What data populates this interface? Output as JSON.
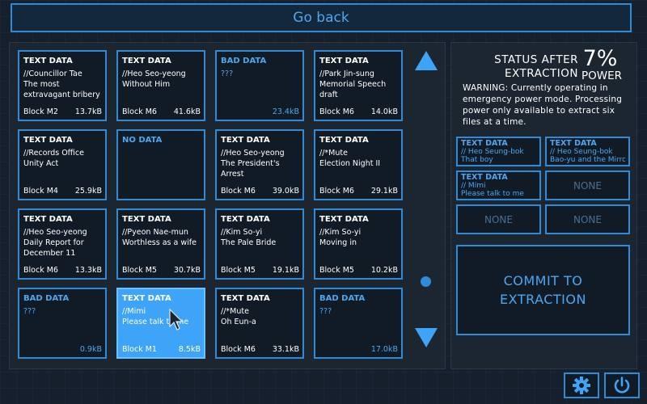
{
  "header": {
    "go_back_label": "Go back"
  },
  "cards": [
    {
      "type": "TEXT DATA",
      "sender": "//Councillor Tae",
      "subject": "The most extravagant bribery",
      "block": "Block M2",
      "size": "13.7kB",
      "variant": "normal"
    },
    {
      "type": "TEXT DATA",
      "sender": "//Heo Seo-yeong",
      "subject": "Without Him",
      "block": "Block M6",
      "size": "41.6kB",
      "variant": "normal"
    },
    {
      "type": "BAD DATA",
      "sender": "???",
      "subject": "",
      "block": "",
      "size": "23.4kB",
      "variant": "bad"
    },
    {
      "type": "TEXT DATA",
      "sender": "//Park Jin-sung",
      "subject": "Memorial Speech draft",
      "block": "Block M6",
      "size": "14.0kB",
      "variant": "normal"
    },
    {
      "type": "TEXT DATA",
      "sender": "//Records Office",
      "subject": "Unity Act",
      "block": "Block M4",
      "size": "25.9kB",
      "variant": "normal"
    },
    {
      "type": "NO DATA",
      "sender": "",
      "subject": "",
      "block": "",
      "size": "",
      "variant": "nodata"
    },
    {
      "type": "TEXT DATA",
      "sender": "//Heo Seo-yeong",
      "subject": "The President's Arrest",
      "block": "Block M6",
      "size": "39.0kB",
      "variant": "normal"
    },
    {
      "type": "TEXT DATA",
      "sender": "//*Mute",
      "subject": "Election Night II",
      "block": "Block M6",
      "size": "29.1kB",
      "variant": "normal"
    },
    {
      "type": "TEXT DATA",
      "sender": "//Heo Seo-yeong",
      "subject": "Daily Report for December 11",
      "block": "Block M6",
      "size": "13.3kB",
      "variant": "normal"
    },
    {
      "type": "TEXT DATA",
      "sender": "//Pyeon Nae-mun",
      "subject": "Worthless as a wife",
      "block": "Block M5",
      "size": "30.7kB",
      "variant": "normal"
    },
    {
      "type": "TEXT DATA",
      "sender": "//Kim So-yi",
      "subject": "The Pale Bride",
      "block": "Block M5",
      "size": "19.1kB",
      "variant": "normal"
    },
    {
      "type": "TEXT DATA",
      "sender": "//Kim So-yi",
      "subject": "Moving in",
      "block": "Block M5",
      "size": "10.2kB",
      "variant": "normal"
    },
    {
      "type": "BAD DATA",
      "sender": "???",
      "subject": "",
      "block": "",
      "size": "0.9kB",
      "variant": "bad"
    },
    {
      "type": "TEXT DATA",
      "sender": "//Mimi",
      "subject": "Please talk to me",
      "block": "Block M1",
      "size": "8.5kB",
      "variant": "selected"
    },
    {
      "type": "TEXT DATA",
      "sender": "//*Mute",
      "subject": "Oh Eun-a",
      "block": "Block M6",
      "size": "33.1kB",
      "variant": "normal"
    },
    {
      "type": "BAD DATA",
      "sender": "???",
      "subject": "",
      "block": "",
      "size": "17.0kB",
      "variant": "bad"
    }
  ],
  "status": {
    "title_line1": "STATUS AFTER",
    "title_line2": "EXTRACTION",
    "power_percent": "7%",
    "power_label": "POWER",
    "warning": "WARNING: Currently operating in emergency power mode. Processing power only available to extract six files at a time."
  },
  "slots": [
    {
      "type": "TEXT DATA",
      "sender": "// Heo Seung-bok",
      "subject": "That boy",
      "empty": false
    },
    {
      "type": "TEXT DATA",
      "sender": "// Heo Seung-bok",
      "subject": "Bao-yu and the Mirror",
      "empty": false
    },
    {
      "type": "TEXT DATA",
      "sender": "// Mimi",
      "subject": "Please talk to me",
      "empty": false
    },
    {
      "label": "NONE",
      "empty": true
    },
    {
      "label": "NONE",
      "empty": true
    },
    {
      "label": "NONE",
      "empty": true
    }
  ],
  "commit": {
    "line1": "COMMIT TO",
    "line2": "EXTRACTION"
  },
  "colors": {
    "accent": "#2f8bd8",
    "accent_text": "#4ba7f2",
    "selected_bg": "#3ea4f7",
    "panel_bg": "#1b2631"
  },
  "icons": {
    "settings": "gear-icon",
    "power": "power-icon",
    "scroll_up": "triangle-up-icon",
    "scroll_down": "triangle-down-icon"
  }
}
